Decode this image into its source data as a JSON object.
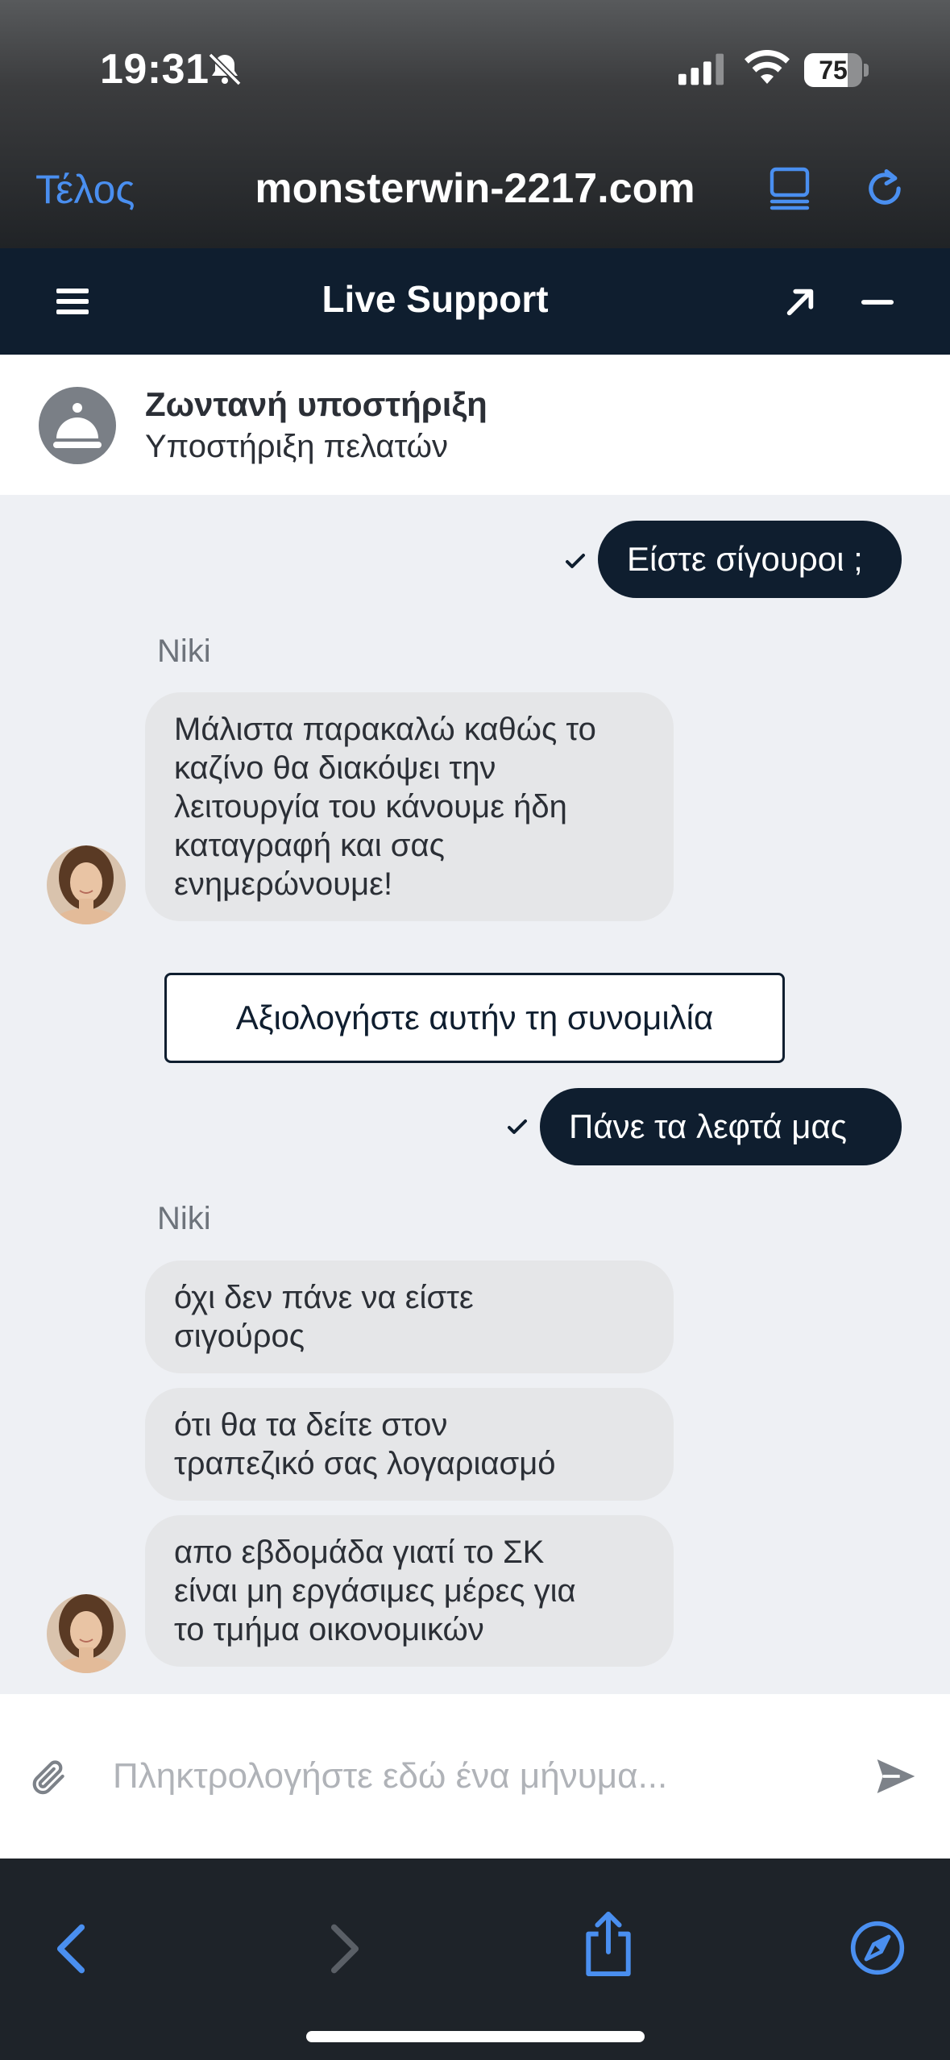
{
  "status_bar": {
    "time": "19:31",
    "battery": "75",
    "battery_level": 0.75
  },
  "browser": {
    "done_label": "Τέλος",
    "url": "monsterwin-2217.com"
  },
  "chat_header": {
    "title": "Live Support"
  },
  "agent_bar": {
    "name": "Ζωντανή υποστήριξη",
    "role": "Υποστήριξη πελατών"
  },
  "messages": {
    "out1": "Είστε σίγουροι ;",
    "sender1": "Niki",
    "in1": [
      "Μάλιστα παρακαλώ καθώς το",
      "καζίνο θα διακόψει  την",
      "λειτουργία του κάνουμε ήδη",
      "καταγραφή και σας",
      "ενημερώνουμε!"
    ],
    "rate_label": "Αξιολογήστε αυτήν τη συνομιλία",
    "out2": "Πάνε τα λεφτά μας",
    "sender2": "Niki",
    "in2": [
      "όχι δεν πάνε να είστε",
      "σιγούρος"
    ],
    "in3": [
      "ότι θα τα δείτε στον",
      "τραπεζικό σας λογαριασμό"
    ],
    "in4": [
      "απο εβδομάδα γιατί το ΣΚ",
      "είναι μη εργάσιμες μέρες για",
      "το τμήμα οικονομικών"
    ]
  },
  "input": {
    "placeholder": "Πληκτρολογήστε εδώ ένα μήνυμα..."
  },
  "colors": {
    "accent_blue": "#4a8ff0",
    "navy": "#0f1e2f",
    "bubble_gray": "#e5e6e8"
  },
  "icons": [
    "bell-slash-icon",
    "signal-icon",
    "wifi-icon",
    "reader-icon",
    "reload-icon",
    "menu-icon",
    "expand-icon",
    "minimize-icon",
    "concierge-bell-icon",
    "check-icon",
    "paperclip-icon",
    "send-icon",
    "back-icon",
    "forward-icon",
    "share-icon",
    "compass-icon"
  ]
}
